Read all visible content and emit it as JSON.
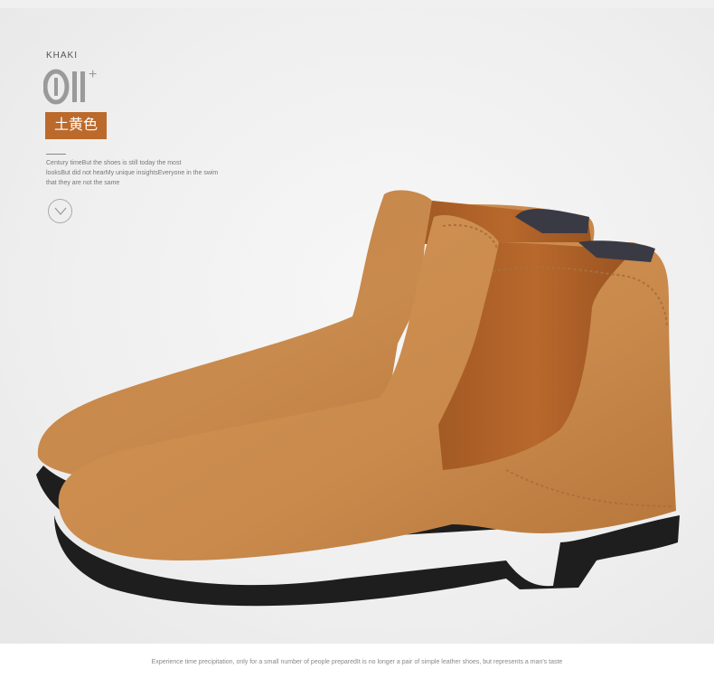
{
  "header": {
    "color_name_en": "KHAKI",
    "variant_number": "01",
    "variant_suffix": "+",
    "color_name_cn": "土黄色"
  },
  "description": {
    "lines": [
      "Century timeBut the shoes is still today the most",
      "looksBut did not hearMy unique insightsEveryone in the swim",
      "that they are not the same"
    ]
  },
  "scroll_hint": {
    "icon": "chevron-down-icon"
  },
  "product_image": {
    "subject": "chelsea-boots-pair"
  },
  "footer": {
    "tagline": "Experience time precipitation, only for a small number of people preparedIt is no longer a pair of simple leather shoes, but represents a man's taste"
  },
  "colors": {
    "accent": "#bb6a2c",
    "suede": "#c98a4a",
    "sole": "#1e1e1e",
    "background": "#efefef"
  }
}
